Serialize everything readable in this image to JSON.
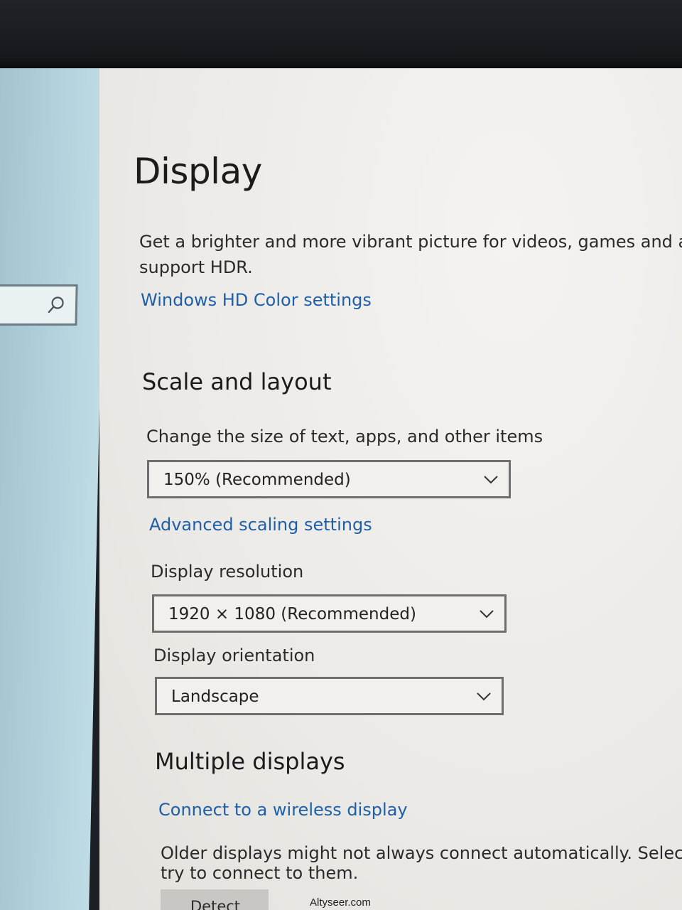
{
  "page": {
    "title": "Display"
  },
  "search": {
    "icon": "search-icon"
  },
  "hdr": {
    "description_line1": "Get a brighter and more vibrant picture for videos, games and ap",
    "description_line2": "support HDR.",
    "link": "Windows HD Color settings"
  },
  "scale_layout": {
    "heading": "Scale and layout",
    "size_label": "Change the size of text, apps, and other items",
    "size_value": "150% (Recommended)",
    "advanced_link": "Advanced scaling settings",
    "resolution_label": "Display resolution",
    "resolution_value": "1920 × 1080 (Recommended)",
    "orientation_label": "Display orientation",
    "orientation_value": "Landscape"
  },
  "multiple_displays": {
    "heading": "Multiple displays",
    "wireless_link": "Connect to a wireless display",
    "older_line1": "Older displays might not always connect automatically. Select Detect t",
    "older_line2": "try to connect to them.",
    "detect_label": "Detect"
  },
  "watermark": "Altyseer.com",
  "colors": {
    "link": "#1f5fa8",
    "sidebar": "#b1d1dc",
    "content_bg": "#eceae6"
  }
}
